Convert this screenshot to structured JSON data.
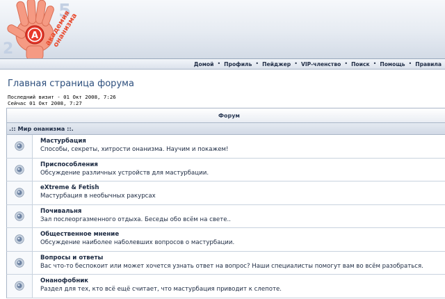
{
  "logo": {
    "line1": "академия",
    "line2": "онанизма",
    "letter": "А"
  },
  "nav": {
    "items": [
      "Домой",
      "Профиль",
      "Пейджер",
      "VIP-членство",
      "Поиск",
      "Помощь",
      "Правила"
    ],
    "separator": "•"
  },
  "page": {
    "title": "Главная страница форума",
    "last_visit": "Последний визит - 01 Окт 2008, 7:26",
    "now": "Сейчас 01 Окт 2008, 7:27"
  },
  "table": {
    "header": "Форум",
    "category": ".:: Мир онанизма ::."
  },
  "forums": [
    {
      "name": "Мастурбация",
      "desc": "Способы, секреты, хитрости онанизма. Научим и покажем!"
    },
    {
      "name": "Приспособления",
      "desc": "Обсуждение различных устройств для мастурбации."
    },
    {
      "name": "eXtreme & Fetish",
      "desc": "Мастурбация в необычных ракурсах"
    },
    {
      "name": "Почивальня",
      "desc": "Зал послеоргазменного отдыха. Беседы обо всём на свете.."
    },
    {
      "name": "Общественное мнение",
      "desc": "Обсуждение наиболее наболевших вопросов о мастурбации."
    },
    {
      "name": "Вопросы и ответы",
      "desc": "Вас что-то беспокоит или может хочется узнать ответ на вопрос? Наши специалисты помогут вам во всём разобраться."
    },
    {
      "name": "Онанофобник",
      "desc": "Раздел для тех, кто всё ещё считает, что мастурбация приводит к слепоте."
    }
  ],
  "colors": {
    "title": "#2d4f7d",
    "nav_text": "#1f2c45",
    "logo_hand": "#f59a83",
    "logo_circle": "#e8392b"
  }
}
